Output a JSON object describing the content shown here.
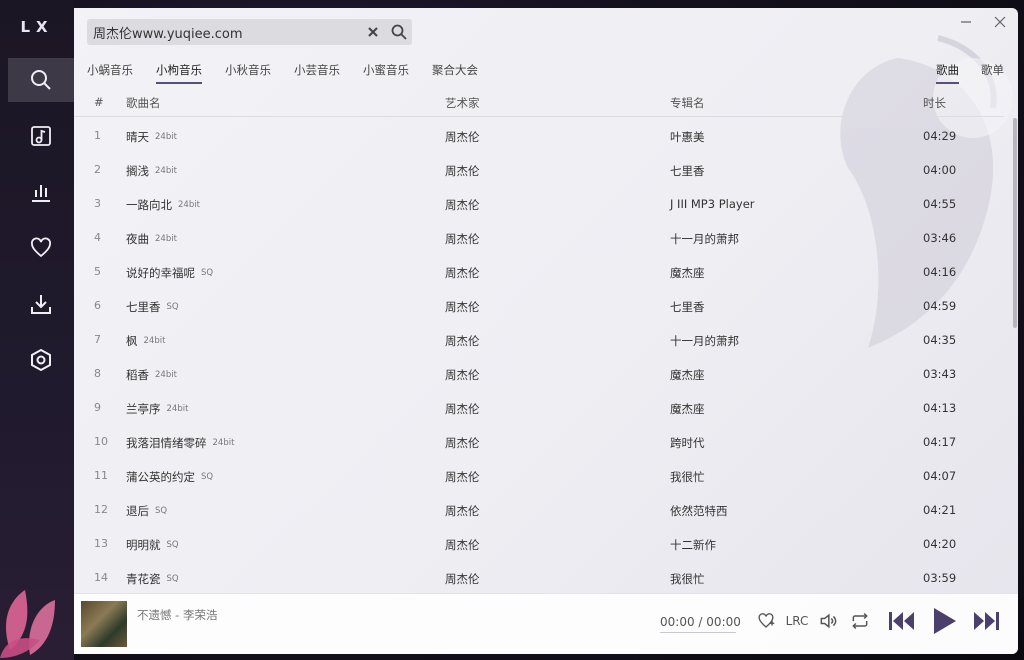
{
  "app": {
    "logo": "LX"
  },
  "sidebar": {
    "items": [
      {
        "name": "search",
        "icon": "search-icon"
      },
      {
        "name": "songlist",
        "icon": "music-list-icon"
      },
      {
        "name": "leaderboard",
        "icon": "chart-icon"
      },
      {
        "name": "favorites",
        "icon": "heart-icon"
      },
      {
        "name": "download",
        "icon": "download-icon"
      },
      {
        "name": "settings",
        "icon": "settings-icon"
      }
    ]
  },
  "search": {
    "value": "周杰伦www.yuqiee.com",
    "placeholder": ""
  },
  "source_tabs": [
    {
      "label": "小蜗音乐",
      "active": false
    },
    {
      "label": "小枸音乐",
      "active": true
    },
    {
      "label": "小秋音乐",
      "active": false
    },
    {
      "label": "小芸音乐",
      "active": false
    },
    {
      "label": "小蜜音乐",
      "active": false
    },
    {
      "label": "聚合大会",
      "active": false
    }
  ],
  "type_tabs": [
    {
      "label": "歌曲",
      "active": true
    },
    {
      "label": "歌单",
      "active": false
    }
  ],
  "table": {
    "headers": {
      "num": "#",
      "name": "歌曲名",
      "artist": "艺术家",
      "album": "专辑名",
      "duration": "时长"
    },
    "rows": [
      {
        "num": "1",
        "name": "晴天",
        "quality": "24bit",
        "artist": "周杰伦",
        "album": "叶惠美",
        "duration": "04:29"
      },
      {
        "num": "2",
        "name": "搁浅",
        "quality": "24bit",
        "artist": "周杰伦",
        "album": "七里香",
        "duration": "04:00"
      },
      {
        "num": "3",
        "name": "一路向北",
        "quality": "24bit",
        "artist": "周杰伦",
        "album": "J III MP3 Player",
        "duration": "04:55"
      },
      {
        "num": "4",
        "name": "夜曲",
        "quality": "24bit",
        "artist": "周杰伦",
        "album": "十一月的萧邦",
        "duration": "03:46"
      },
      {
        "num": "5",
        "name": "说好的幸福呢",
        "quality": "SQ",
        "artist": "周杰伦",
        "album": "魔杰座",
        "duration": "04:16"
      },
      {
        "num": "6",
        "name": "七里香",
        "quality": "SQ",
        "artist": "周杰伦",
        "album": "七里香",
        "duration": "04:59"
      },
      {
        "num": "7",
        "name": "枫",
        "quality": "24bit",
        "artist": "周杰伦",
        "album": "十一月的萧邦",
        "duration": "04:35"
      },
      {
        "num": "8",
        "name": "稻香",
        "quality": "24bit",
        "artist": "周杰伦",
        "album": "魔杰座",
        "duration": "03:43"
      },
      {
        "num": "9",
        "name": "兰亭序",
        "quality": "24bit",
        "artist": "周杰伦",
        "album": "魔杰座",
        "duration": "04:13"
      },
      {
        "num": "10",
        "name": "我落泪情绪零碎",
        "quality": "24bit",
        "artist": "周杰伦",
        "album": "跨时代",
        "duration": "04:17"
      },
      {
        "num": "11",
        "name": "蒲公英的约定",
        "quality": "SQ",
        "artist": "周杰伦",
        "album": "我很忙",
        "duration": "04:07"
      },
      {
        "num": "12",
        "name": "退后",
        "quality": "SQ",
        "artist": "周杰伦",
        "album": "依然范特西",
        "duration": "04:21"
      },
      {
        "num": "13",
        "name": "明明就",
        "quality": "SQ",
        "artist": "周杰伦",
        "album": "十二新作",
        "duration": "04:20"
      },
      {
        "num": "14",
        "name": "青花瓷",
        "quality": "SQ",
        "artist": "周杰伦",
        "album": "我很忙",
        "duration": "03:59"
      }
    ]
  },
  "player": {
    "track": "不遗憾 - 李荣浩",
    "time_current": "00:00",
    "time_sep": "/",
    "time_total": "00:00",
    "lrc_label": "LRC"
  },
  "colors": {
    "accent": "#5a4f7a",
    "sidebar_bg": "#1b1624",
    "panel_bg": "#f0eff4"
  }
}
